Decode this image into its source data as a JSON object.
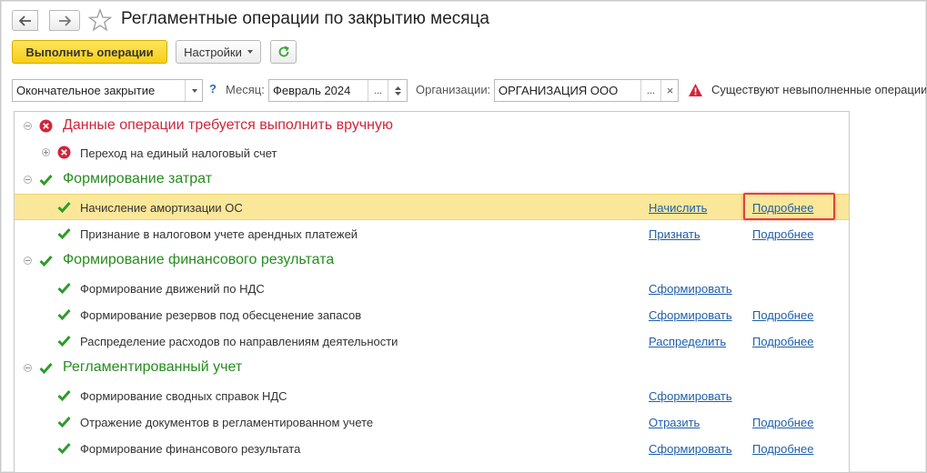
{
  "header": {
    "title": "Регламентные операции по закрытию месяца"
  },
  "toolbar": {
    "run_label": "Выполнить операции",
    "settings_label": "Настройки"
  },
  "filters": {
    "mode_value": "Окончательное закрытие",
    "help": "?",
    "month_label": "Месяц:",
    "month_value": "Февраль 2024",
    "org_label": "Организации:",
    "org_value": "ОРГАНИЗАЦИЯ ООО",
    "ellipsis": "...",
    "clear": "×",
    "warning_text": "Существуют невыполненные операции"
  },
  "groups": {
    "manual": {
      "title": "Данные операции требуется выполнить вручную",
      "items": [
        {
          "label": "Переход на единый налоговый счет"
        }
      ]
    },
    "costs": {
      "title": "Формирование затрат",
      "items": [
        {
          "label": "Начисление амортизации ОС",
          "action": "Начислить",
          "details": "Подробнее"
        },
        {
          "label": "Признание в налоговом учете арендных платежей",
          "action": "Признать",
          "details": "Подробнее"
        }
      ]
    },
    "result": {
      "title": "Формирование финансового результата",
      "items": [
        {
          "label": "Формирование движений по НДС",
          "action": "Сформировать"
        },
        {
          "label": "Формирование резервов под обесценение запасов",
          "action": "Сформировать",
          "details": "Подробнее"
        },
        {
          "label": "Распределение расходов по направлениям деятельности",
          "action": "Распределить",
          "details": "Подробнее"
        }
      ]
    },
    "regulated": {
      "title": "Регламентированный учет",
      "items": [
        {
          "label": "Формирование сводных справок НДС",
          "action": "Сформировать"
        },
        {
          "label": "Отражение документов в регламентированном учете",
          "action": "Отразить",
          "details": "Подробнее"
        },
        {
          "label": "Формирование финансового результата",
          "action": "Сформировать",
          "details": "Подробнее"
        }
      ]
    }
  },
  "colors": {
    "accent_yellow": "#f6cf16",
    "error_red": "#d0263b",
    "ok_green": "#278c1f",
    "link_blue": "#1f5fa8",
    "selection": "#fbe79a",
    "highlight_box": "#e0413d"
  },
  "icons": [
    "back-arrow-icon",
    "forward-arrow-icon",
    "star-icon",
    "refresh-icon",
    "warning-icon",
    "error-icon",
    "check-icon"
  ]
}
